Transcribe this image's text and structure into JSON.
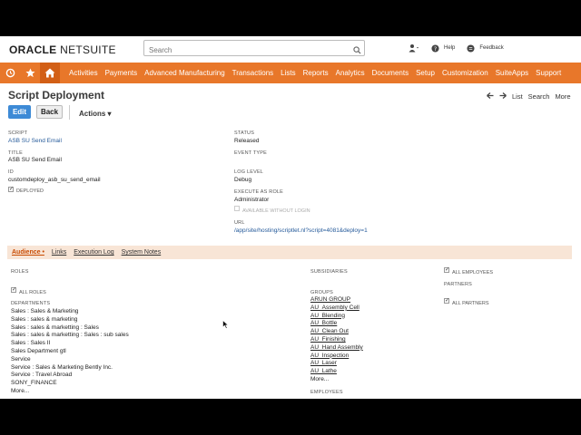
{
  "header": {
    "logo_main": "ORACLE",
    "logo_suffix": "NETSUITE",
    "search_placeholder": "Search",
    "help": "Help",
    "feedback": "Feedback"
  },
  "nav": {
    "items": [
      "Activities",
      "Payments",
      "Advanced Manufacturing",
      "Transactions",
      "Lists",
      "Reports",
      "Analytics",
      "Documents",
      "Setup",
      "Customization",
      "SuiteApps",
      "Support"
    ]
  },
  "page": {
    "title": "Script Deployment",
    "edit": "Edit",
    "back": "Back",
    "actions": "Actions ▾",
    "nav_list": "List",
    "nav_search": "Search",
    "nav_more": "More"
  },
  "fields": {
    "script_label": "SCRIPT",
    "script_value": "ASB SU Send Email",
    "title_label": "TITLE",
    "title_value": "ASB SU Send Email",
    "id_label": "ID",
    "id_value": "customdeploy_asb_su_send_email",
    "deployed_label": "DEPLOYED",
    "status_label": "STATUS",
    "status_value": "Released",
    "event_type_label": "EVENT TYPE",
    "log_level_label": "LOG LEVEL",
    "log_level_value": "Debug",
    "execute_as_label": "EXECUTE AS ROLE",
    "execute_as_value": "Administrator",
    "available_label": "AVAILABLE WITHOUT LOGIN",
    "url_label": "URL",
    "url_value": "/app/site/hosting/scriptlet.nl?script=4081&deploy=1"
  },
  "subtabs": [
    "Audience •",
    "Links",
    "Execution Log",
    "System Notes"
  ],
  "audience": {
    "roles_label": "ROLES",
    "all_roles_label": "ALL ROLES",
    "departments_label": "DEPARTMENTS",
    "departments": [
      "Sales : Sales & Marketing",
      "Sales : sales & marketing",
      "Sales : sales & marketting : Sales",
      "Sales : sales & marketting : Sales : sub sales",
      "Sales : Sales II",
      "Sales Department gtl",
      "Service",
      "Service : Sales & Marketing Bently Inc.",
      "Service : Travel Abroad",
      "SONY_FINANCE",
      "More..."
    ],
    "subsidiaries_label": "SUBSIDIARIES",
    "groups_label": "GROUPS",
    "groups": [
      "ARUN GROUP",
      "AU_Assembly Cell",
      "AU_Blending",
      "AU_Bottle",
      "AU_Clean Out",
      "AU_Finishing",
      "AU_Hand Assembly",
      "AU_Inspection",
      "AU_Laser",
      "AU_Lathe"
    ],
    "groups_more": "More...",
    "employees_label": "EMPLOYEES",
    "all_employees_label": "ALL EMPLOYEES",
    "partners_label": "PARTNERS",
    "all_partners_label": "ALL PARTNERS"
  }
}
